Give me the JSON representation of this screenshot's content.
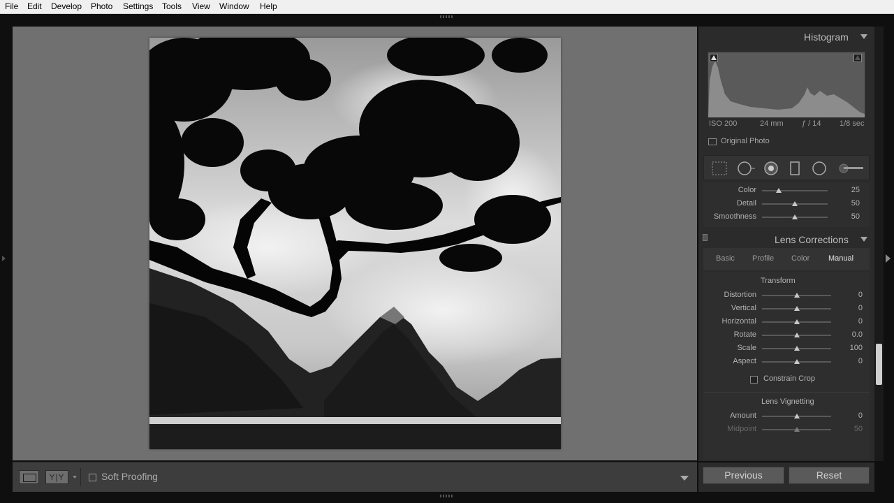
{
  "menu": [
    "File",
    "Edit",
    "Develop",
    "Photo",
    "Settings",
    "Tools",
    "View",
    "Window",
    "Help"
  ],
  "histogram": {
    "title": "Histogram",
    "meta": [
      "ISO 200",
      "24 mm",
      "ƒ / 14",
      "1/8 sec"
    ],
    "original_photo_label": "Original Photo"
  },
  "tools": [
    "crop-overlay-icon",
    "spot-removal-icon",
    "red-eye-icon",
    "graduated-filter-icon",
    "radial-filter-icon",
    "adjustment-brush-icon"
  ],
  "noise": {
    "rows": [
      {
        "label": "Color",
        "value": "25",
        "level": 0.25
      },
      {
        "label": "Detail",
        "value": "50",
        "level": 0.5
      },
      {
        "label": "Smoothness",
        "value": "50",
        "level": 0.5
      }
    ]
  },
  "lens": {
    "title": "Lens Corrections",
    "tabs": [
      "Basic",
      "Profile",
      "Color",
      "Manual"
    ],
    "active_tab": "Manual",
    "transform": {
      "title": "Transform",
      "rows": [
        {
          "label": "Distortion",
          "value": "0",
          "level": 0.5
        },
        {
          "label": "Vertical",
          "value": "0",
          "level": 0.5
        },
        {
          "label": "Horizontal",
          "value": "0",
          "level": 0.5
        },
        {
          "label": "Rotate",
          "value": "0.0",
          "level": 0.5
        },
        {
          "label": "Scale",
          "value": "100",
          "level": 0.5
        },
        {
          "label": "Aspect",
          "value": "0",
          "level": 0.5
        }
      ],
      "constrain_crop": "Constrain Crop"
    },
    "vignetting": {
      "title": "Lens Vignetting",
      "rows": [
        {
          "label": "Amount",
          "value": "0",
          "level": 0.5
        },
        {
          "label": "Midpoint",
          "value": "50",
          "level": 0.5
        }
      ]
    }
  },
  "buttons": {
    "previous": "Previous",
    "reset": "Reset"
  },
  "toolbar": {
    "view_compare": "Y|Y",
    "soft_proofing": "Soft Proofing"
  }
}
